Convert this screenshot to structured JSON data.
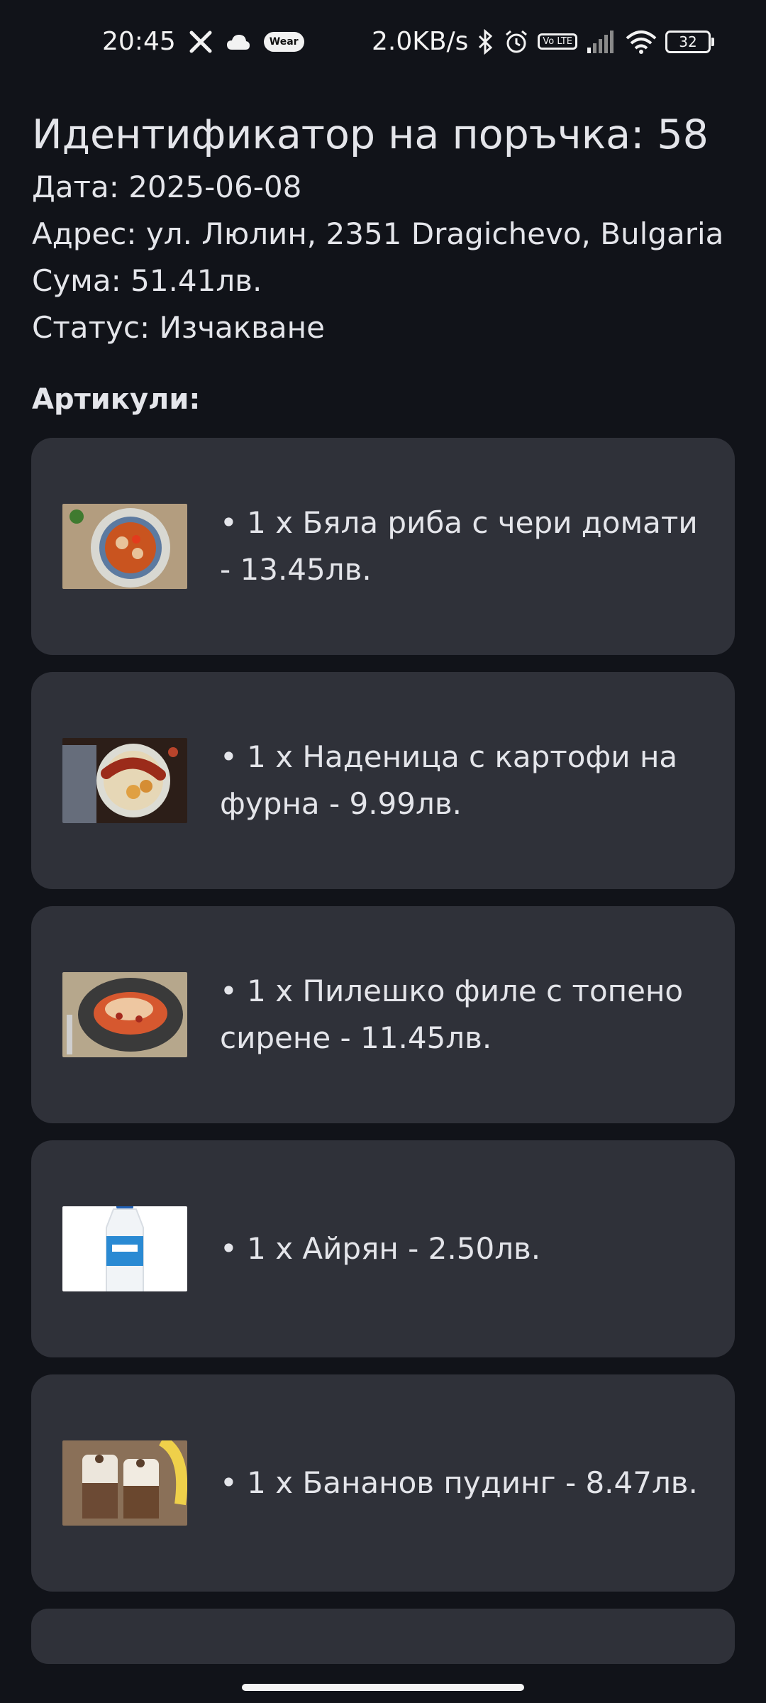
{
  "status_bar": {
    "time": "20:45",
    "network_speed": "2.0KB/s",
    "wear_label": "Wear",
    "volte_label": "Vo LTE",
    "battery_level": "32",
    "icons": [
      "x-icon",
      "cloud-icon",
      "wear-icon",
      "bluetooth-icon",
      "alarm-icon",
      "volte-icon",
      "signal-icon",
      "wifi-icon",
      "battery-icon"
    ]
  },
  "order": {
    "title": "Идентификатор на поръчка: 58",
    "date": "Дата: 2025-06-08",
    "address": "Адрес: ул. Люлин, 2351 Dragichevo, Bulgaria",
    "total": "Сума: 51.41лв.",
    "status": "Статус: Изчакване"
  },
  "items_label": "Артикули:",
  "items": [
    {
      "text": "• 1 x Бяла риба с чери домати - 13.45лв.",
      "image": "fish-cherry-tomatoes-image"
    },
    {
      "text": "• 1 x Наденица с картофи на фурна - 9.99лв.",
      "image": "sausage-baked-potatoes-image"
    },
    {
      "text": "• 1 x Пилешко филе с топено сирене - 11.45лв.",
      "image": "chicken-fillet-cheese-image"
    },
    {
      "text": "• 1 x Айрян - 2.50лв.",
      "image": "ayran-bottle-image"
    },
    {
      "text": "• 1 x Бананов пудинг - 8.47лв.",
      "image": "banana-pudding-image"
    }
  ]
}
